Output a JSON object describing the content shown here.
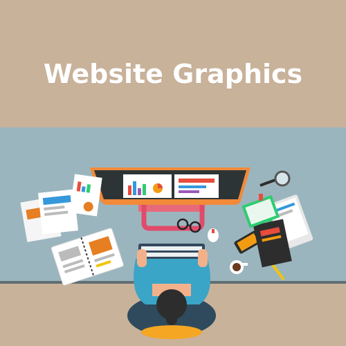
{
  "banner": {
    "title": "Website Graphics",
    "background": "#c9b29a",
    "title_color": "#ffffff"
  },
  "scene": {
    "desk_color": "#9ab4bd",
    "floor_color": "#c9b29a",
    "illustration": "workspace-top-view",
    "icons": [
      "monitor-icon",
      "bar-chart-icon",
      "pie-chart-icon",
      "keyboard-icon",
      "mouse-icon",
      "glasses-icon",
      "magnifier-icon",
      "coffee-cup-icon",
      "notebook-icon",
      "phone-icon",
      "pencil-icon",
      "tablet-icon",
      "person-icon"
    ]
  }
}
